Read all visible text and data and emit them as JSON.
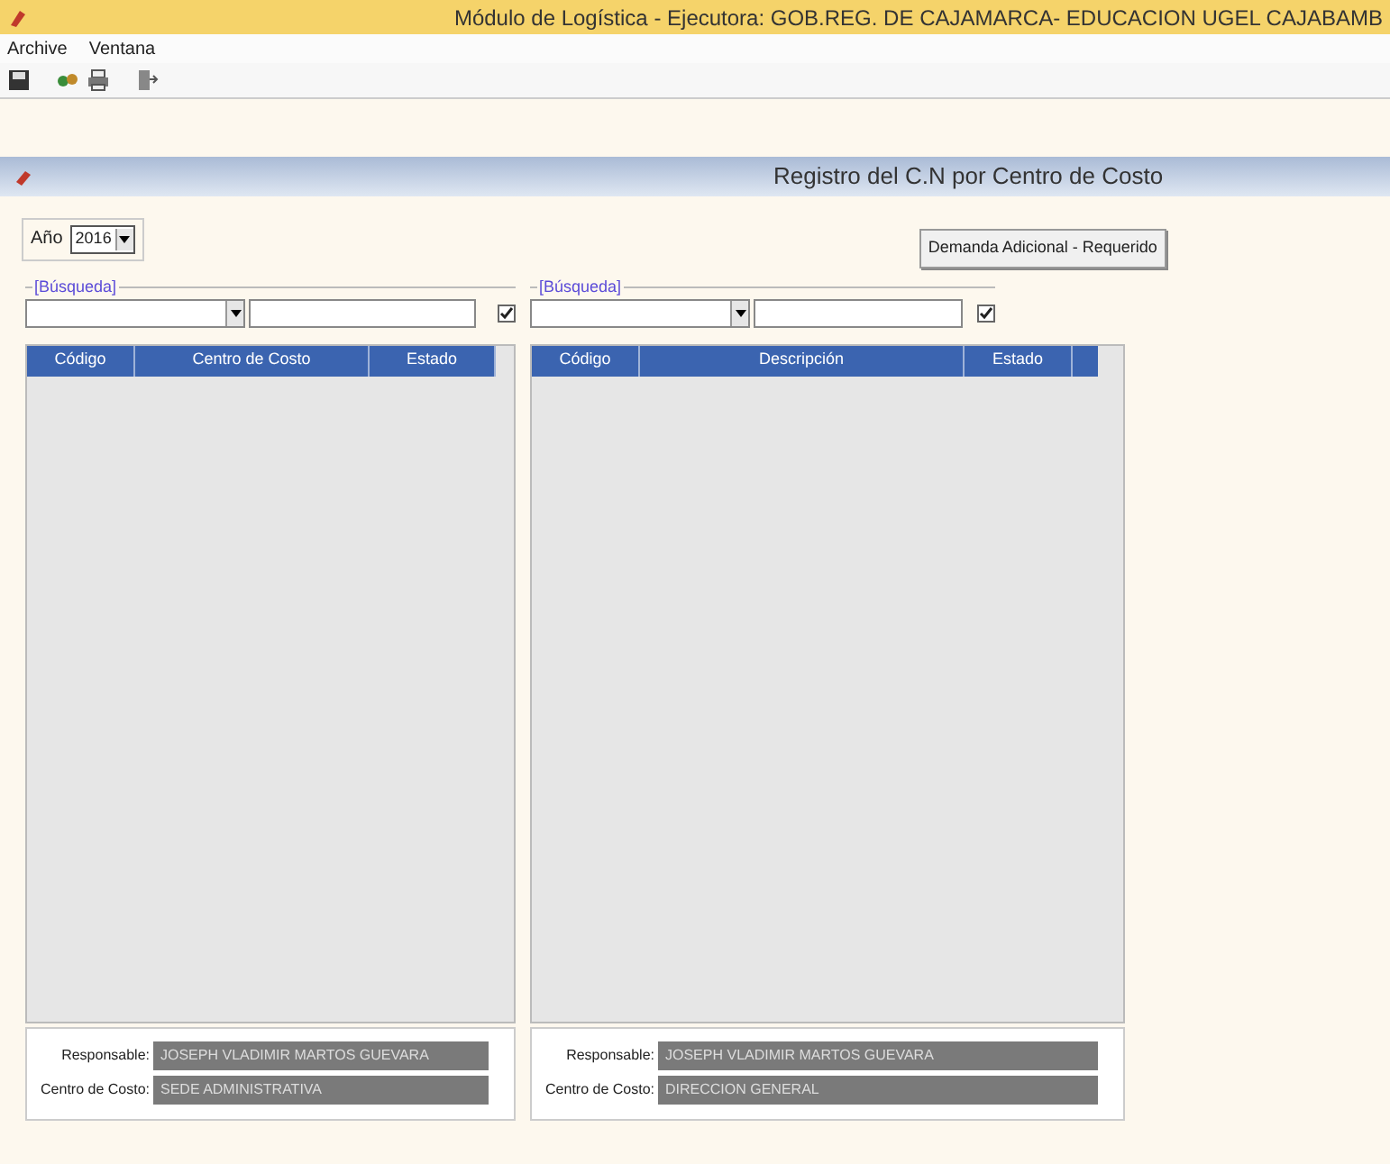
{
  "window": {
    "title": "Módulo de Logística - Ejecutora: GOB.REG. DE CAJAMARCA- EDUCACION UGEL CAJABAMB"
  },
  "menu": [
    "Archive",
    "Ventana"
  ],
  "form": {
    "title": "Registro del C.N por Centro de Costo",
    "year": {
      "label": "Año",
      "value": "2016"
    },
    "button": "Demanda Adicional - Requerido",
    "panels": [
      {
        "search": {
          "legend": "[Búsqueda]",
          "checked": true
        },
        "columns": [
          "Código",
          "Centro de Costo",
          "Estado"
        ],
        "responsable_label": "Responsable:",
        "responsable": "JOSEPH VLADIMIR MARTOS GUEVARA",
        "centro_label": "Centro de Costo:",
        "centro": "SEDE ADMINISTRATIVA"
      },
      {
        "search": {
          "legend": "[Búsqueda]",
          "checked": true
        },
        "columns": [
          "Código",
          "Descripción",
          "Estado"
        ],
        "responsable_label": "Responsable:",
        "responsable": "JOSEPH VLADIMIR MARTOS GUEVARA",
        "centro_label": "Centro de Costo:",
        "centro": "DIRECCION GENERAL"
      }
    ]
  }
}
